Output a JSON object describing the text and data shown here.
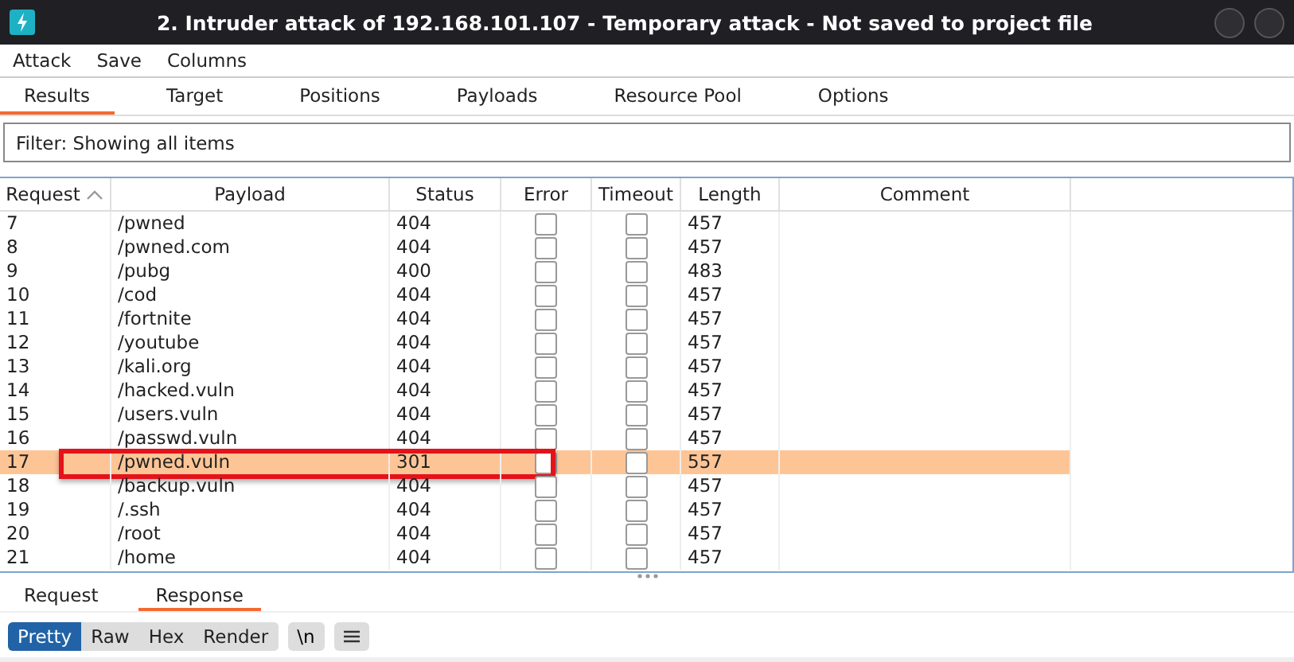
{
  "window": {
    "title": "2. Intruder attack of 192.168.101.107 - Temporary attack - Not saved to project file"
  },
  "menu": [
    "Attack",
    "Save",
    "Columns"
  ],
  "tabs": [
    {
      "label": "Results",
      "selected": true
    },
    {
      "label": "Target",
      "selected": false
    },
    {
      "label": "Positions",
      "selected": false
    },
    {
      "label": "Payloads",
      "selected": false
    },
    {
      "label": "Resource Pool",
      "selected": false
    },
    {
      "label": "Options",
      "selected": false
    }
  ],
  "filter": "Filter: Showing all items",
  "table": {
    "columns": [
      {
        "label": "Request",
        "sorted": true
      },
      {
        "label": "Payload",
        "sorted": false
      },
      {
        "label": "Status",
        "sorted": false
      },
      {
        "label": "Error",
        "sorted": false
      },
      {
        "label": "Timeout",
        "sorted": false
      },
      {
        "label": "Length",
        "sorted": false
      },
      {
        "label": "Comment",
        "sorted": false
      }
    ],
    "rows": [
      {
        "request": "7",
        "payload": "/pwned",
        "status": "404",
        "error": false,
        "timeout": false,
        "length": "457",
        "selected": false,
        "annotated": false
      },
      {
        "request": "8",
        "payload": "/pwned.com",
        "status": "404",
        "error": false,
        "timeout": false,
        "length": "457",
        "selected": false,
        "annotated": false
      },
      {
        "request": "9",
        "payload": "/pubg",
        "status": "400",
        "error": false,
        "timeout": false,
        "length": "483",
        "selected": false,
        "annotated": false
      },
      {
        "request": "10",
        "payload": "/cod",
        "status": "404",
        "error": false,
        "timeout": false,
        "length": "457",
        "selected": false,
        "annotated": false
      },
      {
        "request": "11",
        "payload": "/fortnite",
        "status": "404",
        "error": false,
        "timeout": false,
        "length": "457",
        "selected": false,
        "annotated": false
      },
      {
        "request": "12",
        "payload": "/youtube",
        "status": "404",
        "error": false,
        "timeout": false,
        "length": "457",
        "selected": false,
        "annotated": false
      },
      {
        "request": "13",
        "payload": "/kali.org",
        "status": "404",
        "error": false,
        "timeout": false,
        "length": "457",
        "selected": false,
        "annotated": false
      },
      {
        "request": "14",
        "payload": "/hacked.vuln",
        "status": "404",
        "error": false,
        "timeout": false,
        "length": "457",
        "selected": false,
        "annotated": false
      },
      {
        "request": "15",
        "payload": "/users.vuln",
        "status": "404",
        "error": false,
        "timeout": false,
        "length": "457",
        "selected": false,
        "annotated": false
      },
      {
        "request": "16",
        "payload": "/passwd.vuln",
        "status": "404",
        "error": false,
        "timeout": false,
        "length": "457",
        "selected": false,
        "annotated": false
      },
      {
        "request": "17",
        "payload": "/pwned.vuln",
        "status": "301",
        "error": false,
        "timeout": false,
        "length": "557",
        "selected": true,
        "annotated": true
      },
      {
        "request": "18",
        "payload": "/backup.vuln",
        "status": "404",
        "error": false,
        "timeout": false,
        "length": "457",
        "selected": false,
        "annotated": false
      },
      {
        "request": "19",
        "payload": "/.ssh",
        "status": "404",
        "error": false,
        "timeout": false,
        "length": "457",
        "selected": false,
        "annotated": false
      },
      {
        "request": "20",
        "payload": "/root",
        "status": "404",
        "error": false,
        "timeout": false,
        "length": "457",
        "selected": false,
        "annotated": false
      },
      {
        "request": "21",
        "payload": "/home",
        "status": "404",
        "error": false,
        "timeout": false,
        "length": "457",
        "selected": false,
        "annotated": false
      }
    ]
  },
  "message_tabs": [
    {
      "label": "Request",
      "selected": false
    },
    {
      "label": "Response",
      "selected": true
    }
  ],
  "view_buttons": [
    {
      "label": "Pretty",
      "selected": true
    },
    {
      "label": "Raw",
      "selected": false
    },
    {
      "label": "Hex",
      "selected": false
    },
    {
      "label": "Render",
      "selected": false
    }
  ],
  "newline_button": "\\n"
}
